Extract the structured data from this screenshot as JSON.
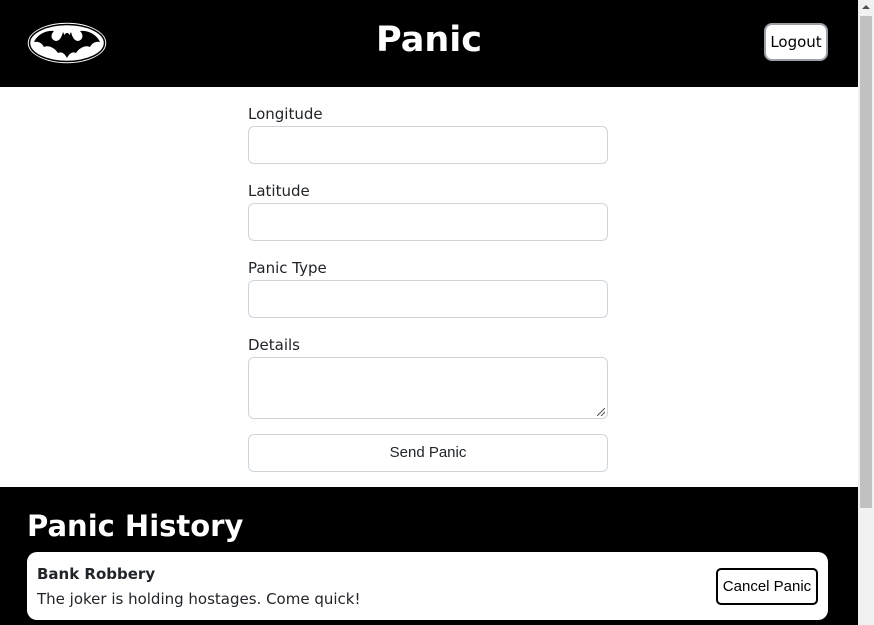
{
  "header": {
    "title": "Panic",
    "logout_label": "Logout",
    "logo_icon": "bat-logo-icon"
  },
  "form": {
    "longitude": {
      "label": "Longitude",
      "value": "",
      "placeholder": ""
    },
    "latitude": {
      "label": "Latitude",
      "value": "",
      "placeholder": ""
    },
    "panic_type": {
      "label": "Panic Type",
      "value": "",
      "placeholder": ""
    },
    "details": {
      "label": "Details",
      "value": "",
      "placeholder": ""
    },
    "send_label": "Send Panic"
  },
  "history": {
    "title": "Panic History",
    "items": [
      {
        "title": "Bank Robbery",
        "details": "The joker is holding hostages. Come quick!",
        "cancel_label": "Cancel Panic"
      }
    ]
  },
  "colors": {
    "header_bg": "#000000",
    "history_bg": "#000000",
    "card_bg": "#ffffff",
    "input_border": "#ced4da"
  }
}
